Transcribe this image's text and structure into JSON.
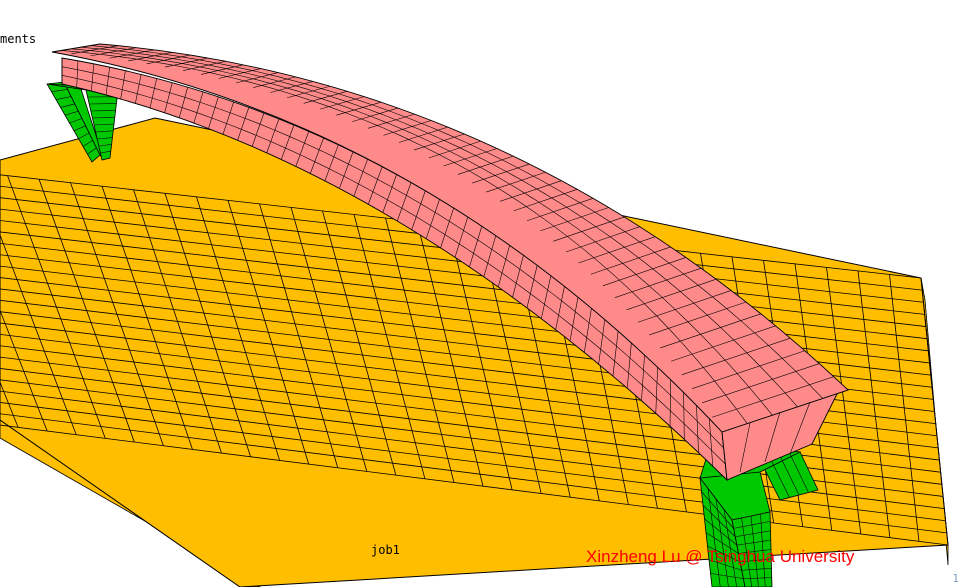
{
  "viewport": {
    "top_label": "ments",
    "job_name": "job1",
    "credit": "Xinzheng Lu @ Tsinghua University",
    "corner_index": "1"
  },
  "colors": {
    "background": "#ffffff",
    "ground": "#ffbe00",
    "deck": "#ff8a8a",
    "piers": "#00c800",
    "mesh_lines": "#000000",
    "credit_text": "#ff0000"
  },
  "objects": [
    {
      "name": "ground-plane",
      "label": "ground mesh"
    },
    {
      "name": "bridge-deck",
      "label": "deck mesh"
    },
    {
      "name": "left-pier",
      "label": "pier mesh"
    },
    {
      "name": "right-pier",
      "label": "pier mesh"
    }
  ]
}
